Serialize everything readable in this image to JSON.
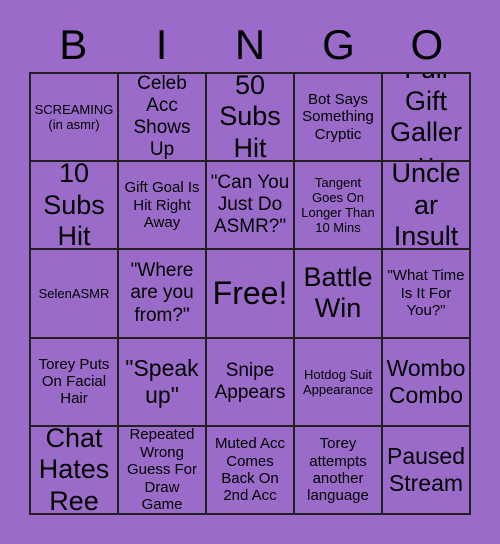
{
  "card": {
    "title_letters": [
      "B",
      "I",
      "N",
      "G",
      "O"
    ],
    "background_color": "#9a6bc9",
    "line_color": "#231f20",
    "text_color": "#000000",
    "rows": [
      [
        {
          "text": "SCREAMING (in asmr)",
          "size": "xs"
        },
        {
          "text": "Celeb Acc Shows Up",
          "size": "md"
        },
        {
          "text": "50 Subs Hit",
          "size": "xl"
        },
        {
          "text": "Bot Says Something Cryptic",
          "size": "sm"
        },
        {
          "text": "Full Gift Gallery",
          "size": "xl"
        }
      ],
      [
        {
          "text": "10 Subs Hit",
          "size": "xl"
        },
        {
          "text": "Gift Goal Is Hit Right Away",
          "size": "sm"
        },
        {
          "text": "\"Can You Just Do ASMR?\"",
          "size": "md"
        },
        {
          "text": "Tangent Goes On Longer Than 10 Mins",
          "size": "xs"
        },
        {
          "text": "Unclear Insult",
          "size": "xl"
        }
      ],
      [
        {
          "text": "SelenASMR",
          "size": "xs"
        },
        {
          "text": "\"Where are you from?\"",
          "size": "md"
        },
        {
          "text": "Free!",
          "size": "free"
        },
        {
          "text": "Battle Win",
          "size": "xl"
        },
        {
          "text": "\"What Time Is It For You?\"",
          "size": "sm"
        }
      ],
      [
        {
          "text": "Torey Puts On Facial Hair",
          "size": "sm"
        },
        {
          "text": "\"Speak up\"",
          "size": "lg"
        },
        {
          "text": "Snipe Appears",
          "size": "md"
        },
        {
          "text": "Hotdog Suit Appearance",
          "size": "xs"
        },
        {
          "text": "Wombo Combo",
          "size": "lg"
        }
      ],
      [
        {
          "text": "Chat Hates Ree",
          "size": "xl"
        },
        {
          "text": "Repeated Wrong Guess For Draw Game",
          "size": "sm"
        },
        {
          "text": "Muted Acc Comes Back On 2nd Acc",
          "size": "sm"
        },
        {
          "text": "Torey attempts another language",
          "size": "sm"
        },
        {
          "text": "Paused Stream",
          "size": "lg"
        }
      ]
    ]
  }
}
